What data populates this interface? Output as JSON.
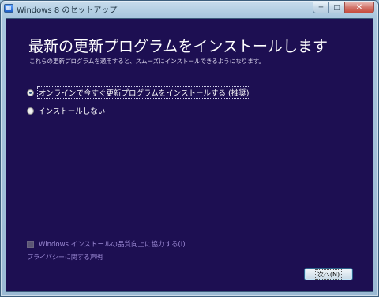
{
  "window": {
    "title": "Windows 8 のセットアップ",
    "minimize_glyph": "─",
    "maximize_glyph": "□",
    "close_glyph": "✕"
  },
  "page": {
    "heading": "最新の更新プログラムをインストールします",
    "subtext": "これらの更新プログラムを適用すると、スムーズにインストールできるようになります。"
  },
  "options": [
    {
      "label": "オンラインで今すぐ更新プログラムをインストールする (推奨)",
      "selected": true
    },
    {
      "label": "インストールしない",
      "selected": false
    }
  ],
  "footer": {
    "quality_checkbox_label": "Windows インストールの品質向上に協力する(I)",
    "quality_checked": false,
    "privacy_link": "プライバシーに関する声明",
    "next_button": "次へ(N)"
  },
  "colors": {
    "background": "#1d0f52",
    "link": "#9d8bd6"
  }
}
